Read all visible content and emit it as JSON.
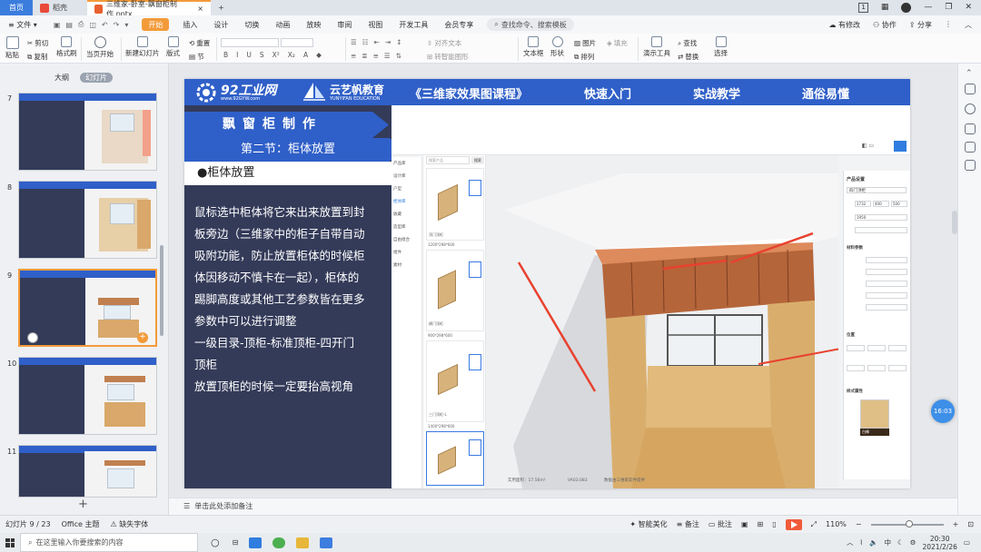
{
  "titlebar": {
    "home_tab": "首页",
    "tab1": "稻壳",
    "tab2": "三维家-卧室-飘窗柜制作.pptx",
    "add_tab": "+",
    "page_indicator": "1"
  },
  "menubar": {
    "file": "文件",
    "items": [
      "开始",
      "插入",
      "设计",
      "切换",
      "动画",
      "放映",
      "审阅",
      "视图",
      "开发工具",
      "会员专享"
    ],
    "search_placeholder": "查找命令、搜索模板",
    "modified": "有修改",
    "collab": "协作",
    "share": "分享"
  },
  "ribbon": {
    "paste": "粘贴",
    "cut": "剪切",
    "copy": "复制",
    "format_painter": "格式刷",
    "from_current": "当页开始",
    "new_slide": "新建幻灯片",
    "layout": "版式",
    "section": "节",
    "reset": "重置",
    "text_box": "文本框",
    "shape": "形状",
    "arrange": "排列",
    "picture": "图片",
    "fill": "填充",
    "presenter_tools": "演示工具",
    "find": "查找",
    "replace": "替换",
    "select": "选择",
    "align_text": "对齐文本",
    "convert_smartart": "转智能图形"
  },
  "leftpanel": {
    "tab_outline": "大纲",
    "tab_slides": "幻灯片",
    "slide_numbers": [
      "7",
      "8",
      "9",
      "10",
      "11"
    ],
    "add_slide": "+"
  },
  "slide": {
    "logo_brand": "92工业网",
    "logo_url": "www.92GYW.com",
    "logo2": "云艺帆教育",
    "logo2_en": "YUNYIFAN EDUCATION",
    "course": "《三维家效果图课程》",
    "tag1": "快速入门",
    "tag2": "实战教学",
    "tag3": "通俗易懂",
    "heading1": "飘窗柜制作",
    "heading2": "第二节：柜体放置",
    "bullet": "●柜体放置",
    "body_lines": [
      "鼠标选中柜体将它来出来放置到封",
      "板旁边（三维家中的柜子自带自动",
      "吸附功能，防止放置柜体的时候柜",
      "体因移动不慎卡在一起），柜体的",
      "踢脚高度或其他工艺参数皆在更多",
      "参数中可以进行调整",
      "一级目录-顶柜-标准顶柜-四开门",
      "顶柜",
      "放置顶柜的时候一定要抬高视角"
    ]
  },
  "shot": {
    "menu": [
      "产品库",
      "设计库",
      "户型",
      "柜体库",
      "收藏",
      "造型库",
      "自由组合",
      "组件",
      "素材"
    ],
    "search_ph": "搜索产品",
    "search_btn": "搜索",
    "product_labels": [
      "顶门顶柜",
      "1200*298*600",
      "横门顶柜",
      "900*298*600",
      "三门顶柜-L",
      "1400*298*600"
    ],
    "panel_title": "产品设置",
    "panel_name": "四门顶柜",
    "dims": [
      "1732",
      "400",
      "500"
    ],
    "height": "1950",
    "section_material": "材料参数",
    "section_pos": "位置",
    "section_style": "样式属性",
    "material_name": "白橡",
    "bottom_label": "实用面积：17.56m²",
    "bottom_label2": "VA03.083",
    "bottom_label3": "数据由三维家软件提供"
  },
  "notes": {
    "placeholder": "单击此处添加备注"
  },
  "statusbar": {
    "slide_pos": "幻灯片 9 / 23",
    "theme": "Office 主题",
    "missing_font": "缺失字体",
    "beautify": "智能美化",
    "notes": "备注",
    "comments": "批注",
    "zoom": "110%"
  },
  "rightbar": {
    "timer": "16:03"
  },
  "taskbar": {
    "search_placeholder": "在这里输入你要搜索的内容",
    "ime": "中",
    "time": "20:30",
    "date": "2021/2/26"
  },
  "colors": {
    "accent_orange": "#f39b3a",
    "banner_blue": "#2f5fc8",
    "dark_panel": "#343b59",
    "arrow_red": "#e8412f"
  }
}
